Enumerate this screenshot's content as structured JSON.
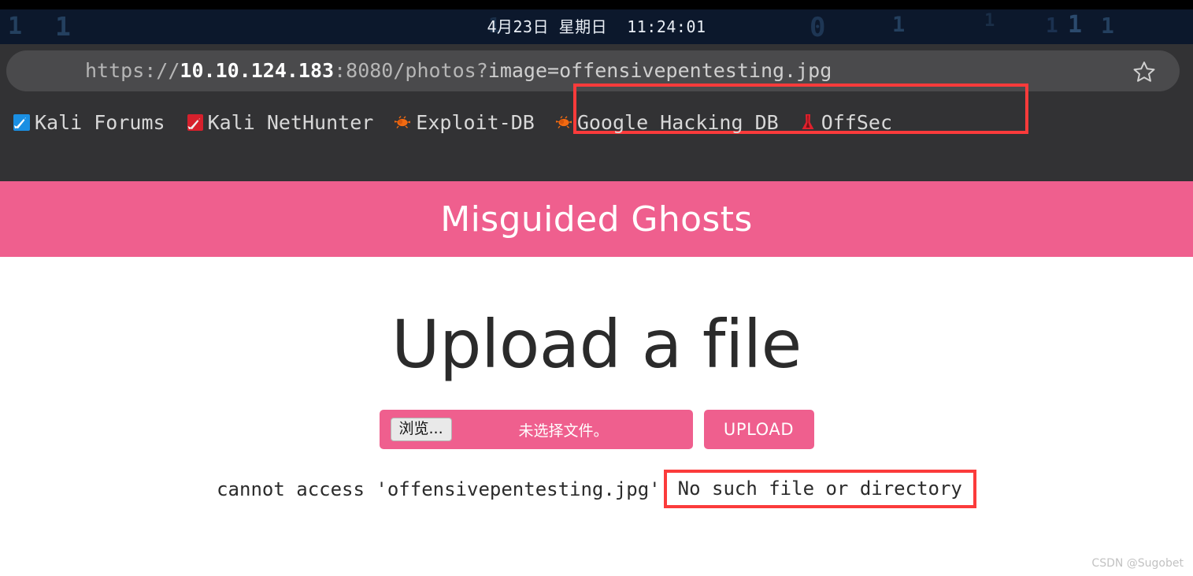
{
  "desktop": {
    "clock": "4月23日 星期日  11:24:01",
    "matrix_glyphs": [
      "1",
      "1",
      "1",
      "0",
      "1",
      "1",
      "1",
      "1",
      "1"
    ]
  },
  "browser": {
    "url": {
      "scheme": "https://",
      "host": "10.10.124.183",
      "path": ":8080/photos?",
      "query": "image=offensivepentesting.jpg",
      "full": "https://10.10.124.183:8080/photos?image=offensivepentesting.jpg"
    },
    "star_icon": "star-outline-icon",
    "bookmarks": [
      {
        "label": "Kali Forums",
        "icon": "kali-dragon-blue-icon"
      },
      {
        "label": "Kali NetHunter",
        "icon": "kali-dragon-red-icon"
      },
      {
        "label": "Exploit-DB",
        "icon": "exploitdb-bug-icon"
      },
      {
        "label": "Google Hacking DB",
        "icon": "exploitdb-bug-icon"
      },
      {
        "label": "OffSec",
        "icon": "offsec-dragon-icon"
      }
    ]
  },
  "page": {
    "banner_title": "Misguided Ghosts",
    "heading": "Upload a file",
    "upload_form": {
      "browse_label": "浏览...",
      "file_status": "未选择文件。",
      "upload_label": "UPLOAD"
    },
    "error": {
      "prefix": "cannot access 'offensivepentesting.jpg'",
      "highlighted": "No such file or directory"
    }
  },
  "watermark": "CSDN @Sugobet",
  "colors": {
    "accent_pink": "#ef5f8e",
    "annotation_red": "#fb3b3b",
    "chrome_gray": "#323234",
    "urlbar_gray": "#4a4a4c",
    "topbar_navy": "#0c182c"
  }
}
